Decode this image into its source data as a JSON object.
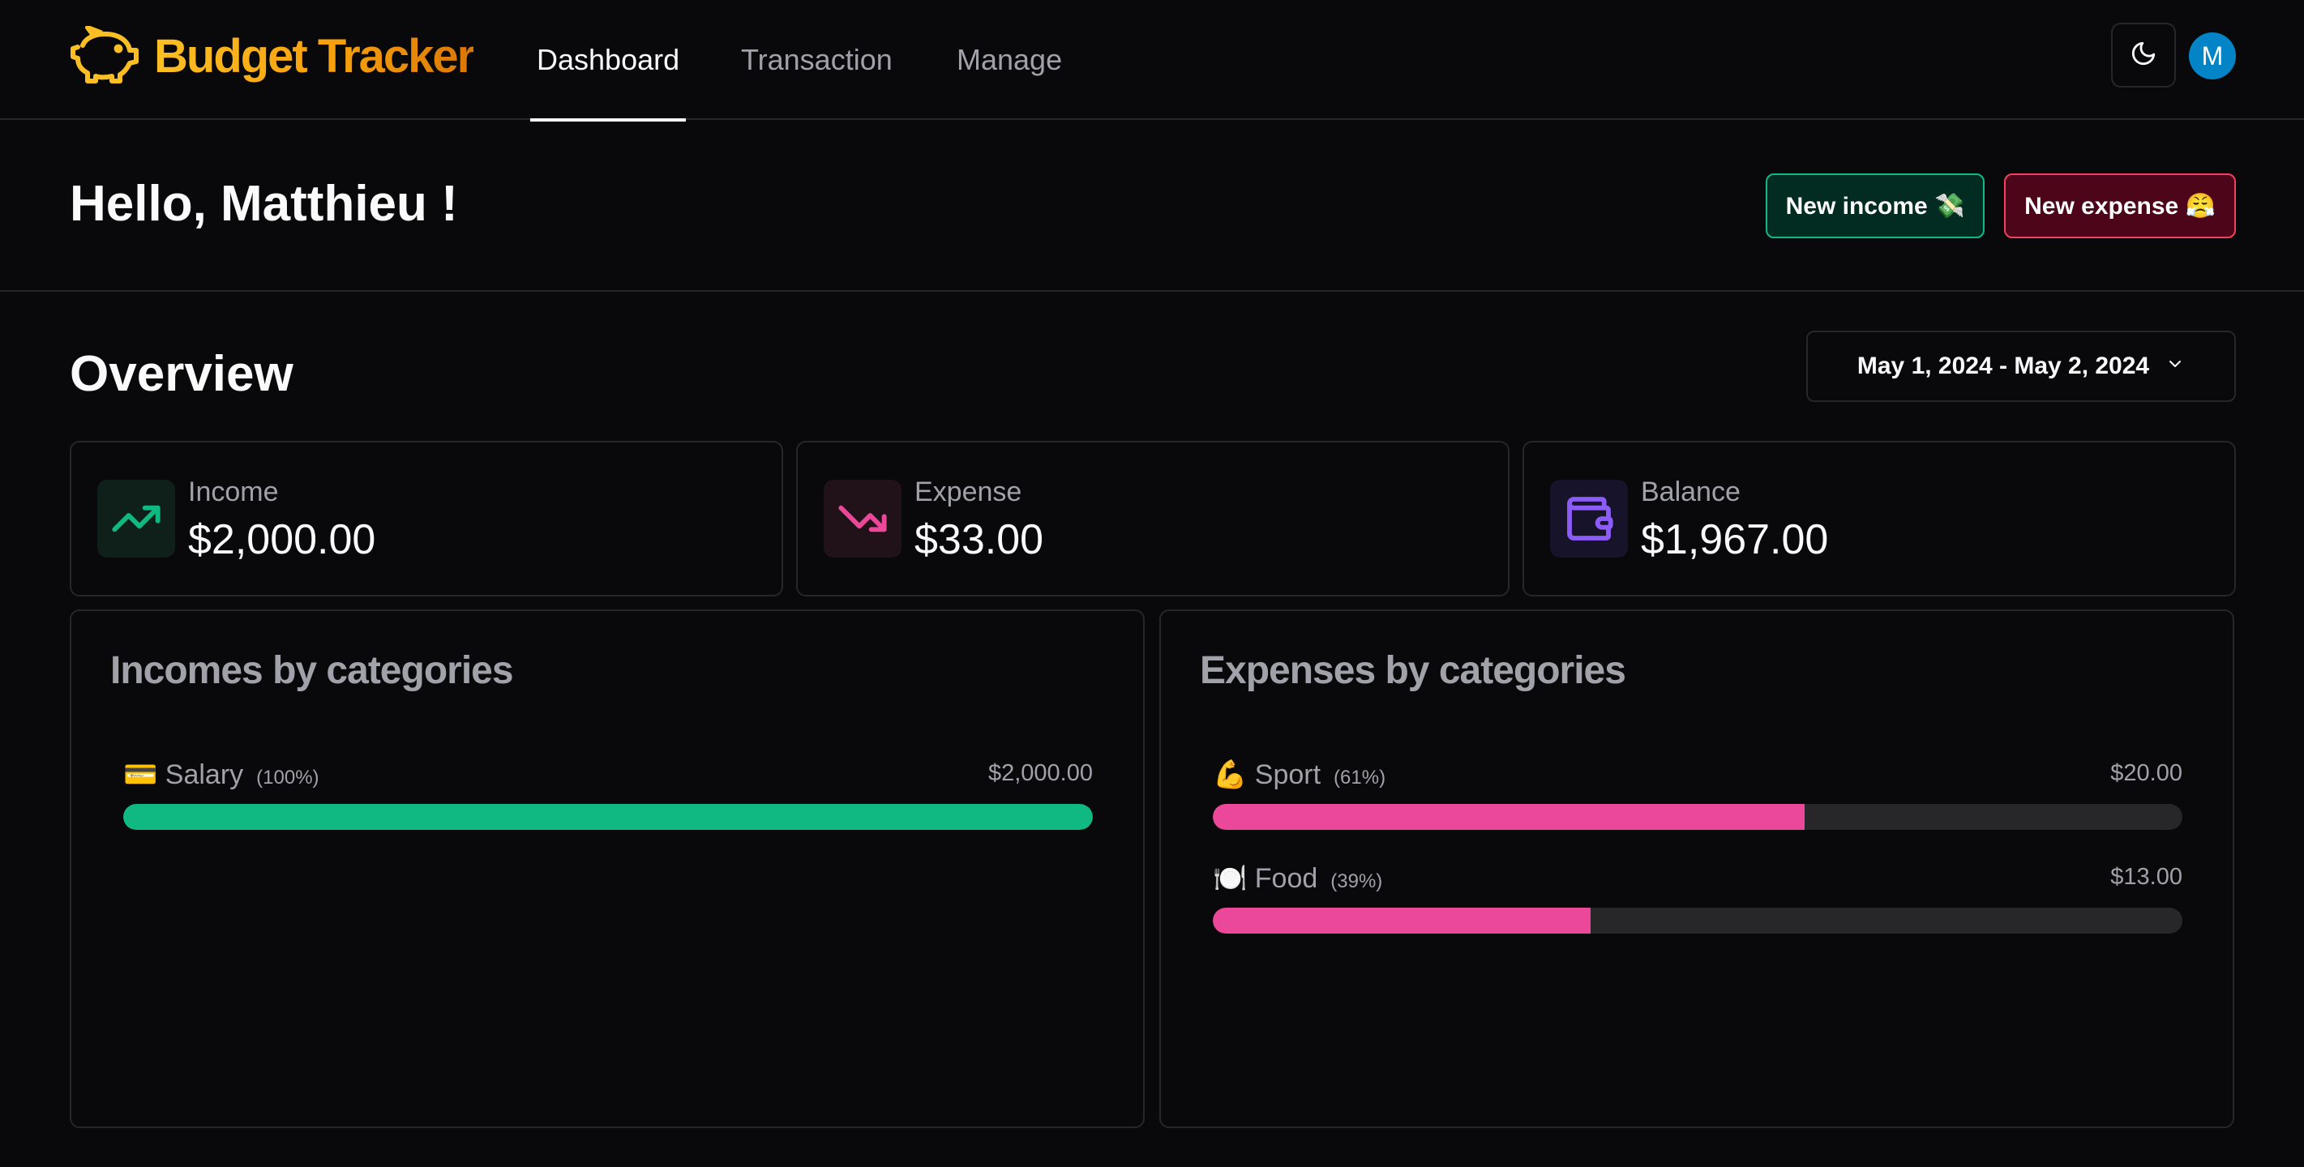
{
  "app": {
    "name": "Budget Tracker",
    "logo_icon": "piggy-bank-icon"
  },
  "nav": [
    {
      "label": "Dashboard",
      "active": true
    },
    {
      "label": "Transaction",
      "active": false
    },
    {
      "label": "Manage",
      "active": false
    }
  ],
  "header": {
    "theme_icon": "moon-icon",
    "avatar_initial": "M"
  },
  "greeting": "Hello, Matthieu !",
  "actions": {
    "new_income": "New income 💸",
    "new_expense": "New expense 😤"
  },
  "overview": {
    "title": "Overview",
    "date_range": "May 1, 2024 - May 2, 2024",
    "stats": [
      {
        "label": "Income",
        "value": "$2,000.00",
        "icon": "trending-up-icon",
        "color": "#10b981"
      },
      {
        "label": "Expense",
        "value": "$33.00",
        "icon": "trending-down-icon",
        "color": "#ec4899"
      },
      {
        "label": "Balance",
        "value": "$1,967.00",
        "icon": "wallet-icon",
        "color": "#8b5cf6"
      }
    ]
  },
  "incomes_by_category": {
    "title": "Incomes by categories",
    "color": "#10b981",
    "items": [
      {
        "name": "💳 Salary",
        "percent_label": "(100%)",
        "amount": "$2,000.00",
        "percent": 100
      }
    ]
  },
  "expenses_by_category": {
    "title": "Expenses by categories",
    "color": "#ec4899",
    "items": [
      {
        "name": "💪 Sport",
        "percent_label": "(61%)",
        "amount": "$20.00",
        "percent": 61
      },
      {
        "name": "🍽️ Food",
        "percent_label": "(39%)",
        "amount": "$13.00",
        "percent": 39
      }
    ]
  }
}
